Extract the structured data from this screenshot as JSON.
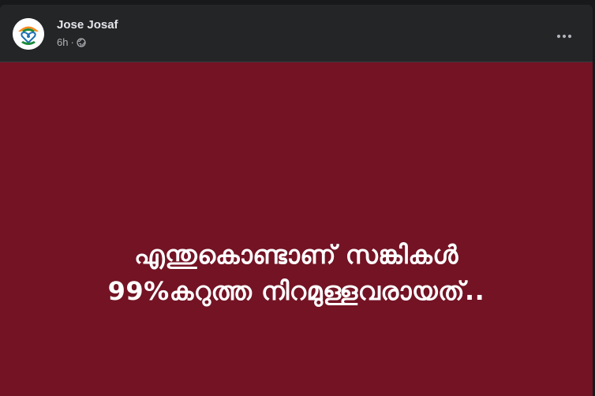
{
  "post": {
    "author": "Jose Josaf",
    "timestamp": "6h",
    "separator": "·",
    "visibility_icon": "globe-icon",
    "more_icon": "more-options-icon",
    "image": {
      "background_color": "#731324",
      "text_color": "#ffffff",
      "line1": "എന്തുകൊണ്ടാണ് സങ്കികൾ",
      "line2": "99%കറുത്ത നിറമുള്ളവരായത്.."
    }
  }
}
